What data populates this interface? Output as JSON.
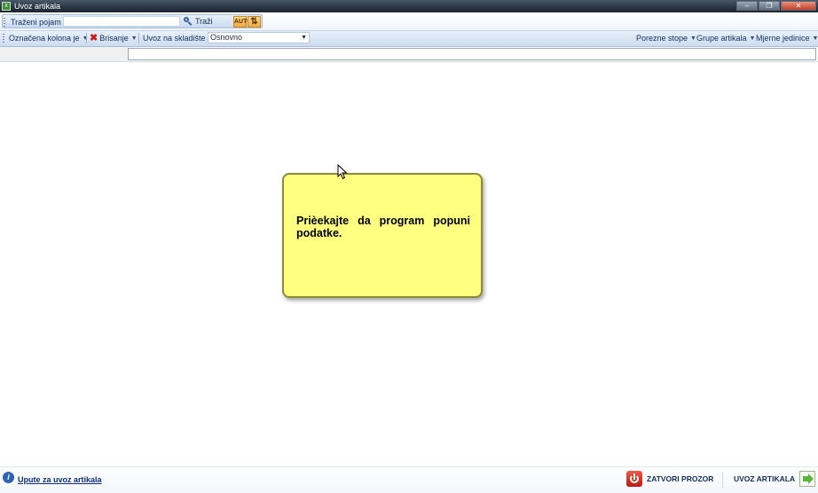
{
  "window": {
    "title": "Uvoz artikala",
    "icon": "excel-sheet-icon"
  },
  "search": {
    "label": "Traženi pojam",
    "value": "",
    "button_label": "Traži",
    "icon": "magnifier-icon",
    "extra_buttons": [
      {
        "name": "auto-width-columns-icon",
        "glyph": "AUTO"
      },
      {
        "name": "sort-columns-icon",
        "glyph": "⇅"
      }
    ]
  },
  "toolbar": {
    "marked_column_label": "Označena kolona je",
    "delete_label": "Brisanje",
    "warehouse_label": "Uvoz na skladište :",
    "warehouse_value": "Osnovno",
    "right_menus": [
      "Porezne stope",
      "Grupe artikala",
      "Mjerne jedinice"
    ]
  },
  "message": {
    "text": "Prièekajte da program popuni podatke.",
    "color": "#ffff80"
  },
  "footer": {
    "help_link": "Upute za uvoz artikala",
    "close_button": "ZATVORI PROZOR",
    "import_button": "UVOZ ARTIKALA"
  },
  "colors": {
    "titlebar": "#2c3846",
    "toolbar": "#cddcef",
    "close_red": "#c0412c",
    "import_green": "#5bb33b"
  }
}
